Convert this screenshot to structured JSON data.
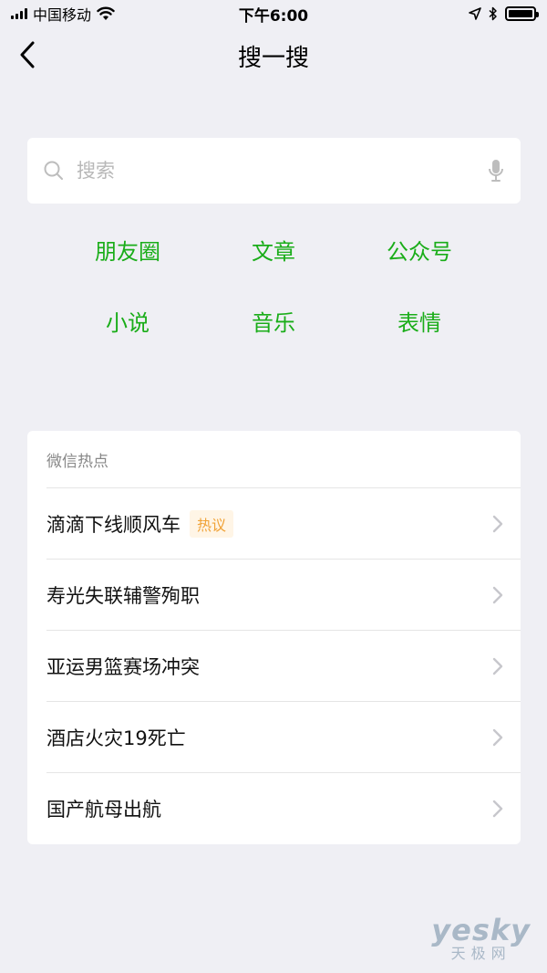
{
  "status_bar": {
    "carrier": "中国移动",
    "time": "下午6:00",
    "icons": [
      "signal-icon",
      "wifi-icon",
      "location-arrow-icon",
      "bluetooth-icon",
      "battery-icon"
    ]
  },
  "nav": {
    "title": "搜一搜",
    "back_icon": "back-chevron-icon"
  },
  "search": {
    "placeholder": "搜索",
    "icons": [
      "search-icon",
      "microphone-icon"
    ]
  },
  "categories": {
    "items": [
      {
        "label": "朋友圈"
      },
      {
        "label": "文章"
      },
      {
        "label": "公众号"
      },
      {
        "label": "小说"
      },
      {
        "label": "音乐"
      },
      {
        "label": "表情"
      }
    ],
    "color": "#1aad19"
  },
  "hot": {
    "title": "微信热点",
    "items": [
      {
        "text": "滴滴下线顺风车",
        "tag": "热议"
      },
      {
        "text": "寿光失联辅警殉职"
      },
      {
        "text": "亚运男篮赛场冲突"
      },
      {
        "text": "酒店火灾19死亡"
      },
      {
        "text": "国产航母出航"
      }
    ],
    "tag_color": "#f0a236"
  },
  "watermark": {
    "brand": "yesky",
    "subtitle": "天极网"
  }
}
